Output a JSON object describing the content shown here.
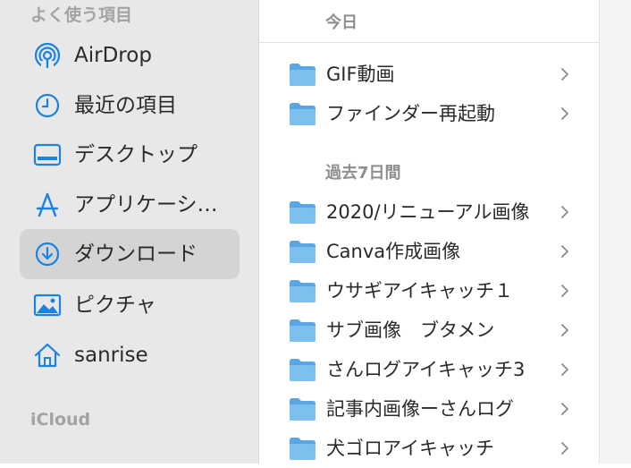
{
  "sidebar": {
    "favorites_header": "よく使う項目",
    "items": [
      {
        "label": "AirDrop",
        "icon": "airdrop-icon",
        "selected": false
      },
      {
        "label": "最近の項目",
        "icon": "clock-icon",
        "selected": false
      },
      {
        "label": "デスクトップ",
        "icon": "desktop-icon",
        "selected": false
      },
      {
        "label": "アプリケーシ…",
        "icon": "applications-icon",
        "selected": false
      },
      {
        "label": "ダウンロード",
        "icon": "download-icon",
        "selected": true
      },
      {
        "label": "ピクチャ",
        "icon": "pictures-icon",
        "selected": false
      },
      {
        "label": "sanrise",
        "icon": "home-icon",
        "selected": false
      }
    ],
    "icloud_header": "iCloud"
  },
  "main": {
    "groups": [
      {
        "header": "今日",
        "items": [
          "GIF動画",
          "ファインダー再起動"
        ]
      },
      {
        "header": "過去7日間",
        "items": [
          "2020/リニューアル画像",
          "Canva作成画像",
          "ウサギアイキャッチ１",
          "サブ画像　ブタメン",
          "さんログアイキャッチ3",
          "記事内画像ーさんログ",
          "犬ゴロアイキャッチ"
        ]
      }
    ]
  },
  "colors": {
    "sidebar_bg": "#e9e8e9",
    "selected_bg": "#d5d4d5",
    "accent_blue": "#1a82e0",
    "folder_blue": "#71b7ec"
  }
}
